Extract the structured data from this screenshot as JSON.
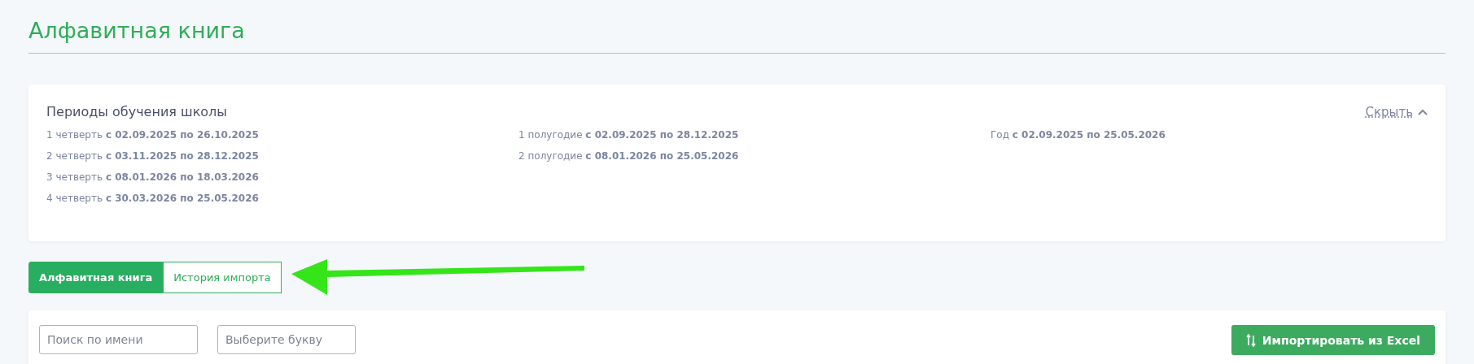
{
  "page_title": "Алфавитная книга",
  "periods_card": {
    "title": "Периоды обучения школы",
    "hide_link": "Скрыть",
    "columns": [
      {
        "items": [
          "1 четверть **с 02.09.2025 по 26.10.2025**",
          "2 четверть **с 03.11.2025 по 28.12.2025**",
          "3 четверть **с 08.01.2026 по 18.03.2026**",
          "4 четверть **с 30.03.2026 по 25.05.2026**"
        ]
      },
      {
        "items": [
          "1 полугодие **с 02.09.2025 по 28.12.2025**",
          "2 полугодие **с 08.01.2026 по 25.05.2026**"
        ]
      },
      {
        "items": [
          "Год **с 02.09.2025 по 25.05.2026**"
        ]
      }
    ]
  },
  "tabs": [
    {
      "label": "Алфавитная книга",
      "selected": true
    },
    {
      "label": "История импорта",
      "selected": false
    }
  ],
  "filters": [
    {
      "placeholder": "Поиск по имени"
    },
    {
      "placeholder": "Выберите букву"
    }
  ],
  "import_button": "Импортировать из Excel"
}
